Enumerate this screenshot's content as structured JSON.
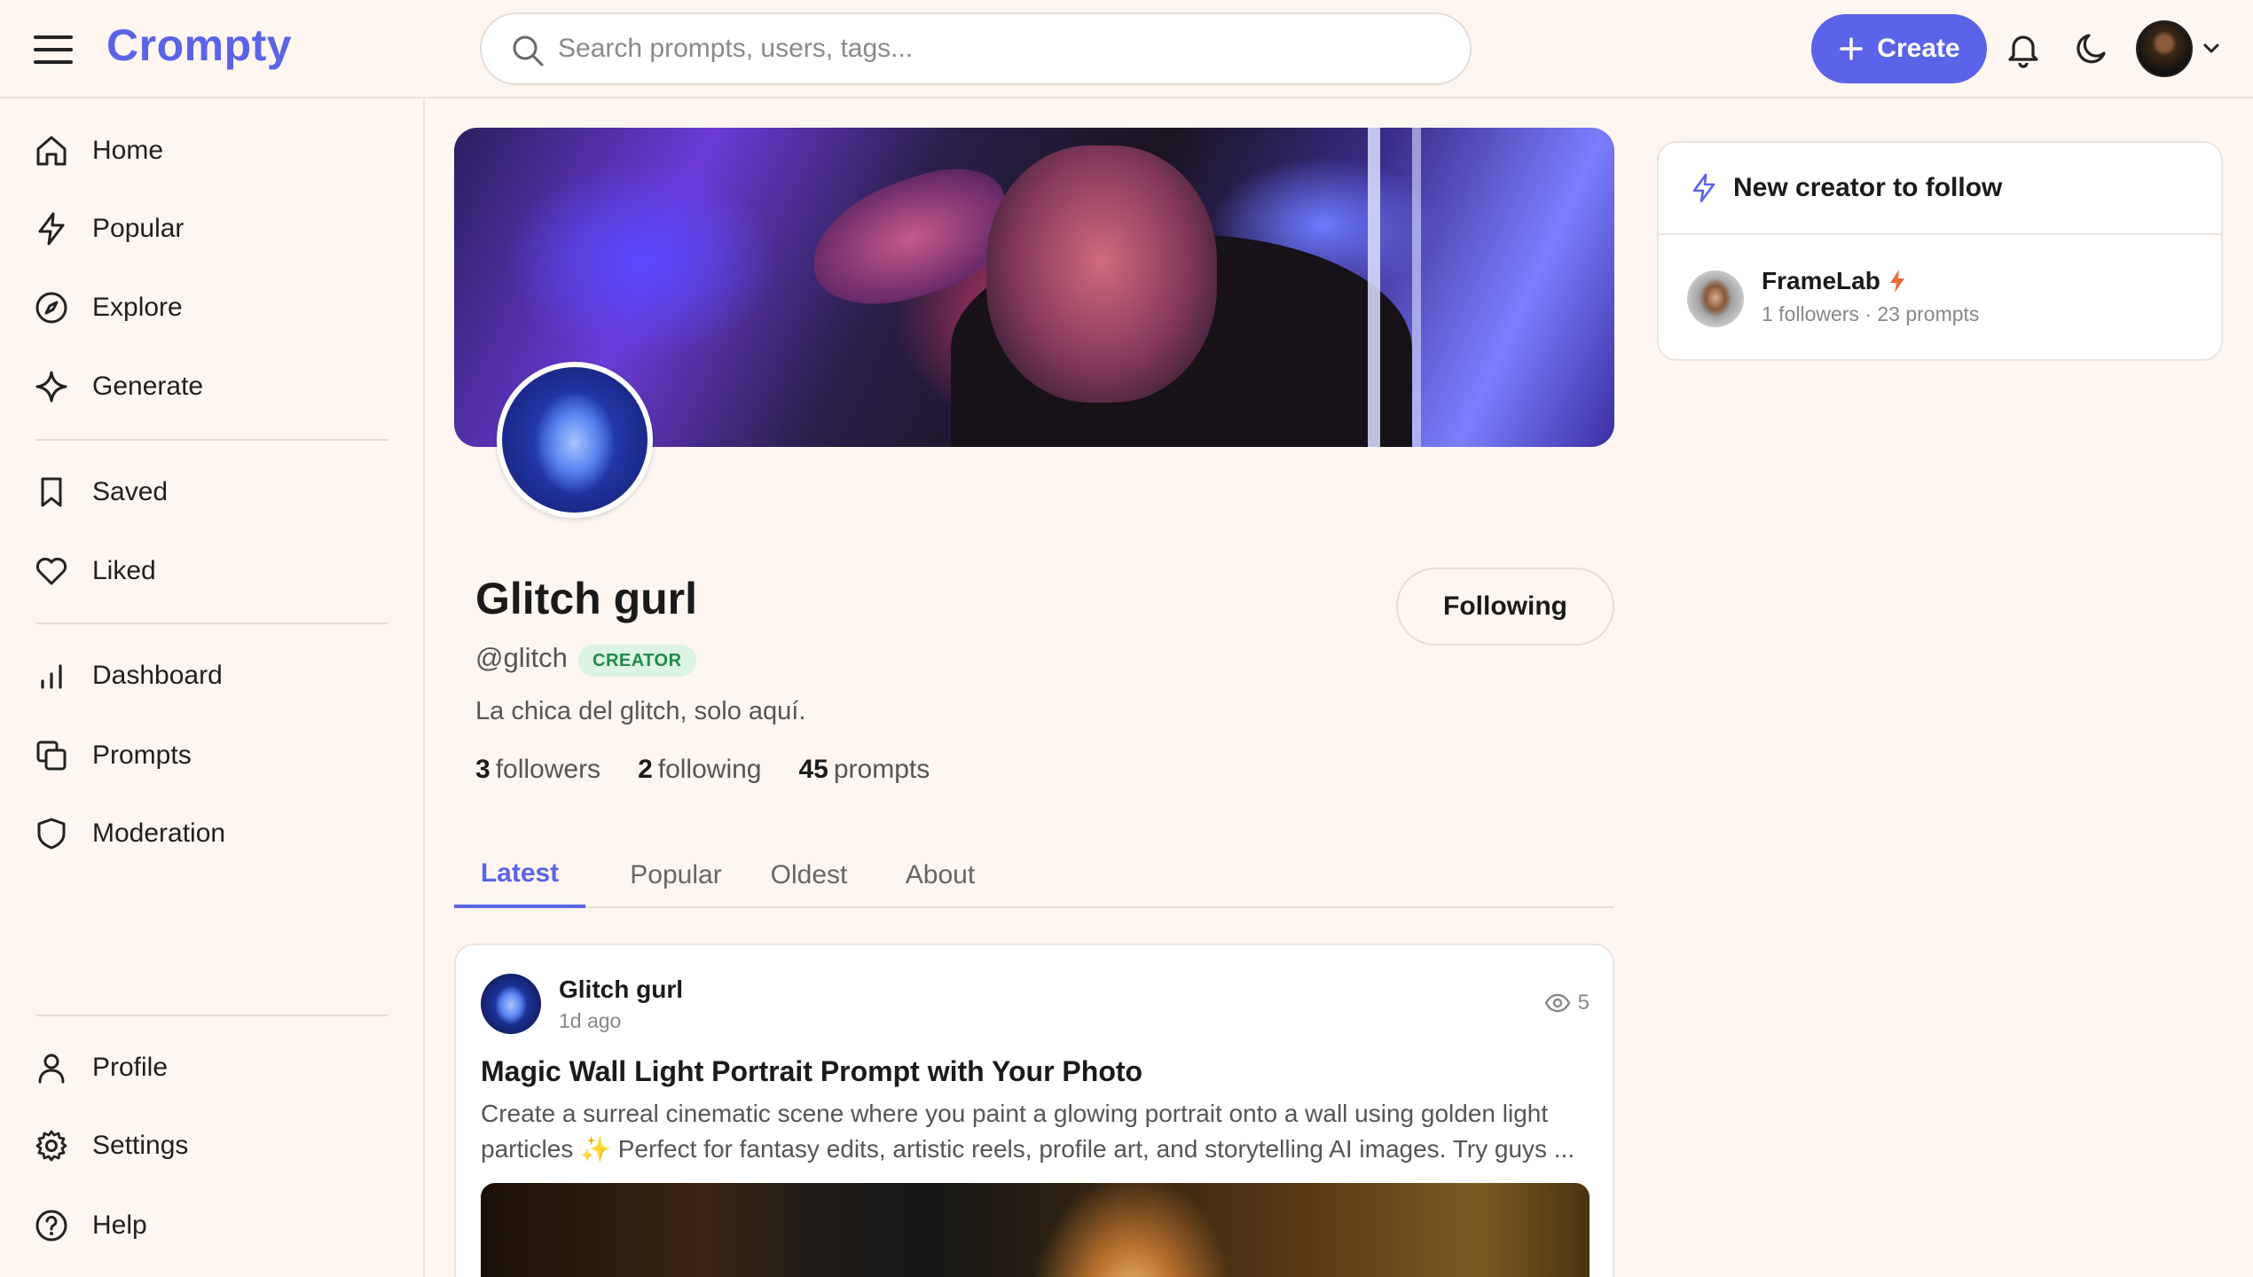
{
  "app": {
    "logo": "Crompty"
  },
  "search": {
    "placeholder": "Search prompts, users, tags..."
  },
  "header": {
    "create_label": "Create"
  },
  "sidebar": {
    "primary": [
      {
        "label": "Home",
        "icon": "home-icon"
      },
      {
        "label": "Popular",
        "icon": "lightning-icon"
      },
      {
        "label": "Explore",
        "icon": "compass-icon"
      },
      {
        "label": "Generate",
        "icon": "sparkle-icon"
      }
    ],
    "library": [
      {
        "label": "Saved",
        "icon": "bookmark-icon"
      },
      {
        "label": "Liked",
        "icon": "heart-icon"
      }
    ],
    "manage": [
      {
        "label": "Dashboard",
        "icon": "bar-chart-icon"
      },
      {
        "label": "Prompts",
        "icon": "copy-icon"
      },
      {
        "label": "Moderation",
        "icon": "shield-icon"
      }
    ],
    "account": [
      {
        "label": "Profile",
        "icon": "user-icon"
      },
      {
        "label": "Settings",
        "icon": "gear-icon"
      },
      {
        "label": "Help",
        "icon": "help-circle-icon"
      }
    ]
  },
  "profile": {
    "name": "Glitch gurl",
    "handle": "@glitch",
    "badge": "CREATOR",
    "bio": "La chica del glitch, solo aquí.",
    "follow_label": "Following",
    "stats": [
      {
        "value": "3",
        "label": "followers"
      },
      {
        "value": "2",
        "label": "following"
      },
      {
        "value": "45",
        "label": "prompts"
      }
    ]
  },
  "tabs": [
    {
      "label": "Latest",
      "active": true
    },
    {
      "label": "Popular",
      "active": false
    },
    {
      "label": "Oldest",
      "active": false
    },
    {
      "label": "About",
      "active": false
    }
  ],
  "post": {
    "author": "Glitch gurl",
    "time": "1d ago",
    "views": "5",
    "title": "Magic Wall Light Portrait Prompt with Your Photo",
    "description_line1": "Create a surreal cinematic scene where you paint a glowing portrait onto a wall using golden light",
    "description_line2_pre": "particles",
    "description_emoji": "✨",
    "description_line2_post": "Perfect for fantasy edits, artistic reels, profile art, and storytelling AI images. Try guys ..."
  },
  "suggestion": {
    "heading": "New creator to follow",
    "creator": {
      "name": "FrameLab",
      "meta": "1 followers · 23 prompts"
    }
  },
  "colors": {
    "accent": "#5b63e8",
    "background": "#fdf6f1",
    "badge_green": "#1f8a4a"
  }
}
